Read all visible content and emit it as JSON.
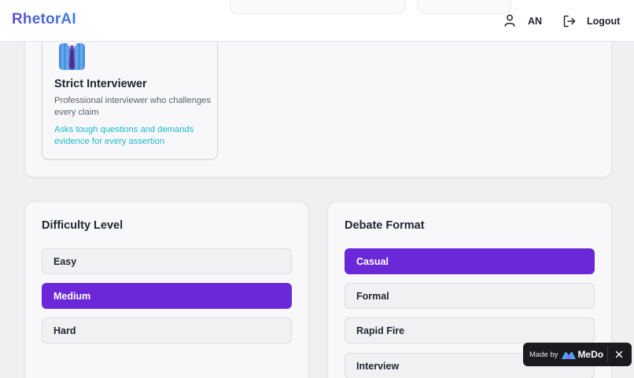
{
  "header": {
    "logo": "RhetorAI",
    "user_icon": "user-icon",
    "user_initials": "AN",
    "logout_icon": "logout-icon",
    "logout_label": "Logout"
  },
  "persona": {
    "avatar_icon": "interviewer-avatar-icon",
    "name": "Strict Interviewer",
    "description": "Professional interviewer who challenges every claim",
    "note": "Asks tough questions and demands evidence for every assertion"
  },
  "difficulty": {
    "title": "Difficulty Level",
    "options": [
      {
        "label": "Easy",
        "selected": false
      },
      {
        "label": "Medium",
        "selected": true
      },
      {
        "label": "Hard",
        "selected": false
      }
    ]
  },
  "format": {
    "title": "Debate Format",
    "options": [
      {
        "label": "Casual",
        "selected": true
      },
      {
        "label": "Formal",
        "selected": false
      },
      {
        "label": "Rapid Fire",
        "selected": false
      },
      {
        "label": "Interview",
        "selected": false
      }
    ]
  },
  "badge": {
    "made_by": "Made by",
    "brand": "MeDo",
    "close_icon": "close-icon"
  },
  "colors": {
    "accent": "#6a28d8",
    "note": "#1ab8cc",
    "logo_start": "#5b4fd0",
    "logo_end": "#3d7fe0"
  }
}
